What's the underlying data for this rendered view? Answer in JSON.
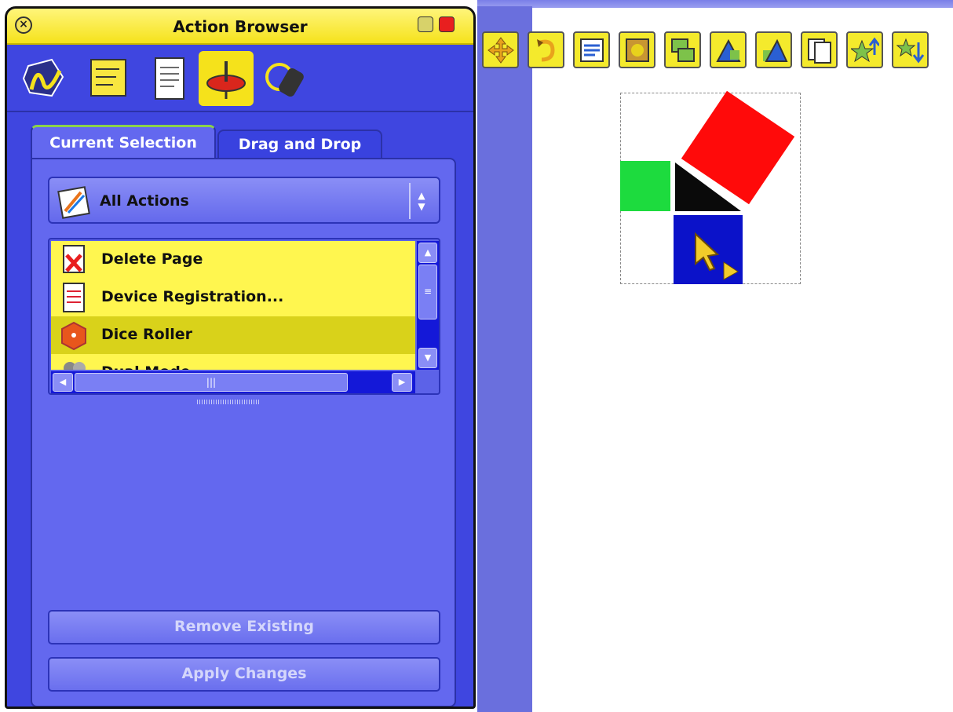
{
  "panel": {
    "title": "Action Browser",
    "tool_tabs": [
      "pen-tools-icon",
      "notes-icon",
      "page-browser-icon",
      "action-browser-icon",
      "resource-icon"
    ],
    "tabs": [
      {
        "label": "Current Selection",
        "active": true
      },
      {
        "label": "Drag and Drop",
        "active": false
      }
    ],
    "category": {
      "label": "All Actions"
    },
    "actions": [
      {
        "label": "Delete Page",
        "icon": "delete-page-icon",
        "selected": false
      },
      {
        "label": "Device Registration...",
        "icon": "device-registration-icon",
        "selected": false
      },
      {
        "label": "Dice Roller",
        "icon": "dice-roller-icon",
        "selected": true
      },
      {
        "label": "Dual Mode",
        "icon": "dual-mode-icon",
        "selected": false
      }
    ],
    "buttons": {
      "remove": "Remove Existing",
      "apply": "Apply Changes"
    }
  },
  "toolbar": {
    "items": [
      "move-icon",
      "rotate-icon",
      "properties-icon",
      "fill-icon",
      "group-icon",
      "bring-forward-icon",
      "send-backward-icon",
      "duplicate-icon",
      "bring-to-front-icon",
      "send-to-back-icon"
    ]
  },
  "colors": {
    "panel_blue": "#3f46e0",
    "accent_yellow": "#f5e21b",
    "shape_red": "#ff0a0a",
    "shape_green": "#1ddb3e",
    "shape_blue": "#0b12c9"
  }
}
